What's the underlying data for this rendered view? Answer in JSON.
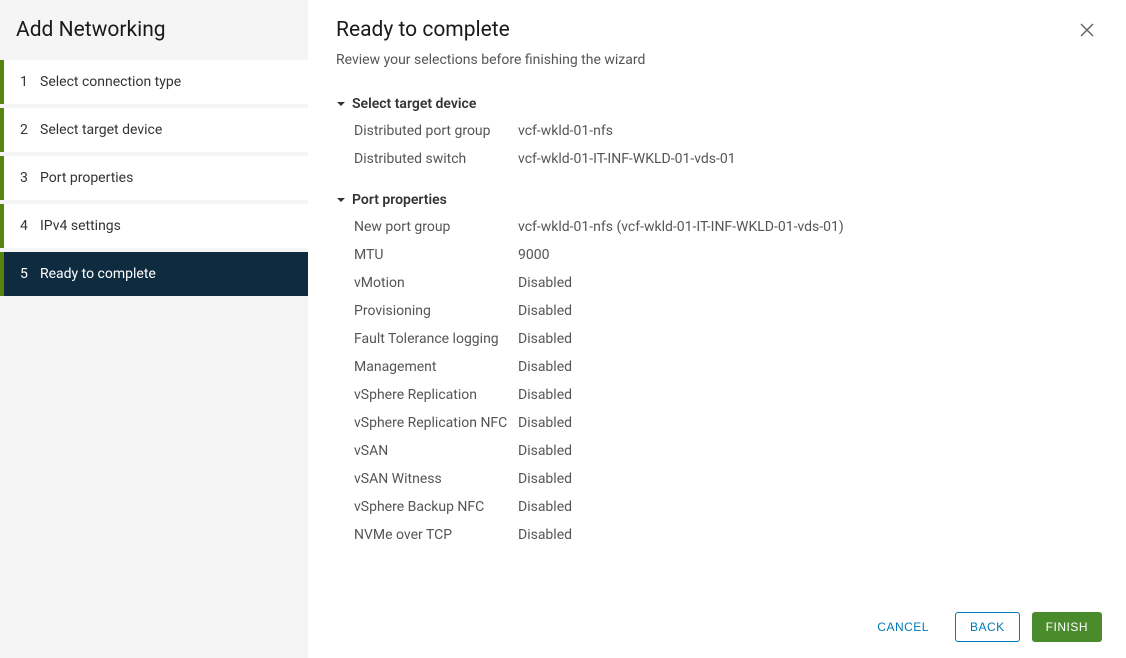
{
  "wizard": {
    "title": "Add Networking",
    "steps": [
      {
        "num": "1",
        "label": "Select connection type"
      },
      {
        "num": "2",
        "label": "Select target device"
      },
      {
        "num": "3",
        "label": "Port properties"
      },
      {
        "num": "4",
        "label": "IPv4 settings"
      },
      {
        "num": "5",
        "label": "Ready to complete"
      }
    ]
  },
  "content": {
    "title": "Ready to complete",
    "subtitle": "Review your selections before finishing the wizard"
  },
  "sections": {
    "targetDevice": {
      "title": "Select target device",
      "rows": [
        {
          "label": "Distributed port group",
          "value": "vcf-wkld-01-nfs"
        },
        {
          "label": "Distributed switch",
          "value": "vcf-wkld-01-IT-INF-WKLD-01-vds-01"
        }
      ]
    },
    "portProperties": {
      "title": "Port properties",
      "rows": [
        {
          "label": "New port group",
          "value": "vcf-wkld-01-nfs (vcf-wkld-01-IT-INF-WKLD-01-vds-01)"
        },
        {
          "label": "MTU",
          "value": "9000"
        },
        {
          "label": "vMotion",
          "value": "Disabled"
        },
        {
          "label": "Provisioning",
          "value": "Disabled"
        },
        {
          "label": "Fault Tolerance logging",
          "value": "Disabled"
        },
        {
          "label": "Management",
          "value": "Disabled"
        },
        {
          "label": "vSphere Replication",
          "value": "Disabled"
        },
        {
          "label": "vSphere Replication NFC",
          "value": "Disabled"
        },
        {
          "label": "vSAN",
          "value": "Disabled"
        },
        {
          "label": "vSAN Witness",
          "value": "Disabled"
        },
        {
          "label": "vSphere Backup NFC",
          "value": "Disabled"
        },
        {
          "label": "NVMe over TCP",
          "value": "Disabled"
        }
      ]
    }
  },
  "buttons": {
    "cancel": "CANCEL",
    "back": "BACK",
    "finish": "FINISH"
  }
}
